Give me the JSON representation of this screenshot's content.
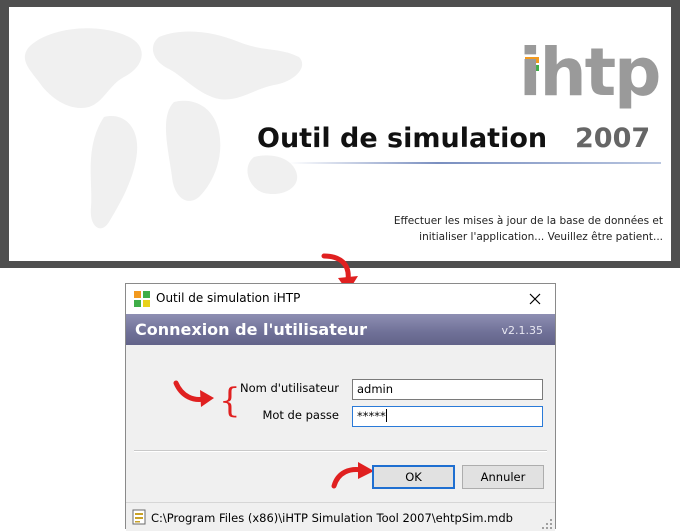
{
  "splash": {
    "logo": "ihtp",
    "title": "Outil de simulation",
    "year": "2007",
    "status_line1": "Effectuer les mises à jour de la base de données et",
    "status_line2": "initialiser l'application... Veuillez être patient..."
  },
  "dialog": {
    "window_title": "Outil de simulation iHTP",
    "banner_title": "Connexion de l'utilisateur",
    "version": "v2.1.35",
    "username_label": "Nom d'utilisateur",
    "username_value": "admin",
    "password_label": "Mot de passe",
    "password_value": "*****",
    "ok_label": "OK",
    "cancel_label": "Annuler",
    "db_path": "C:\\Program Files (x86)\\iHTP Simulation Tool 2007\\ehtpSim.mdb"
  },
  "icons": {
    "app": "grid-app-icon",
    "close": "close-icon",
    "db": "database-file-icon"
  },
  "colors": {
    "banner": "#6f7097",
    "accent_red": "#e02020",
    "focus_blue": "#1f6fd1",
    "logo_green": "#3fae48",
    "logo_orange": "#f29a1f"
  }
}
